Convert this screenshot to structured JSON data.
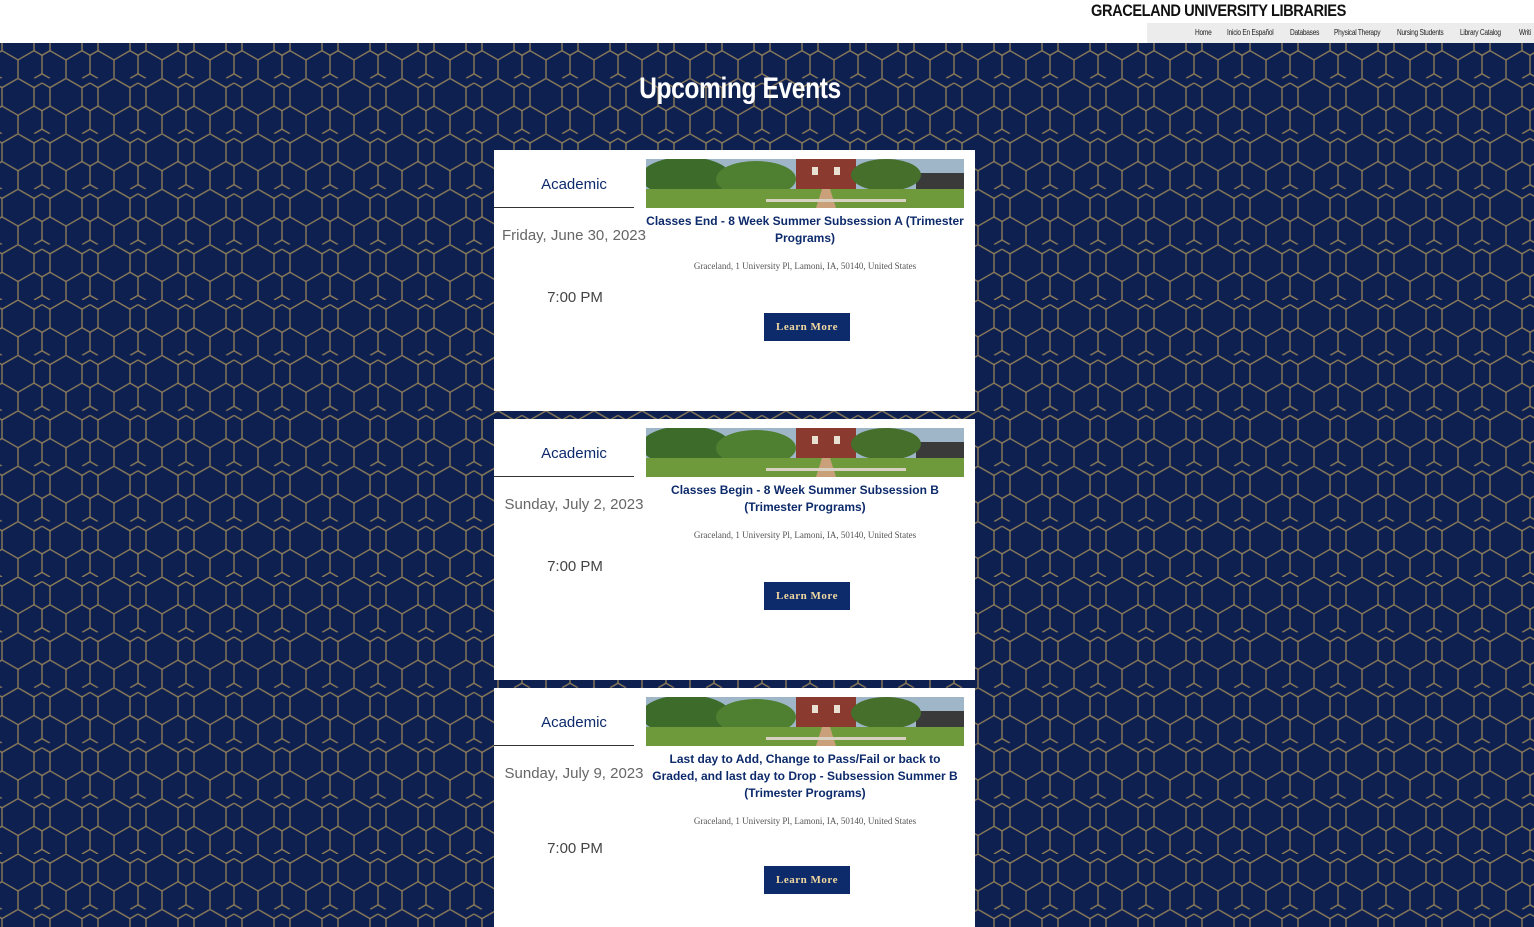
{
  "header": {
    "site_title": "GRACELAND UNIVERSITY LIBRARIES",
    "nav_items": [
      "Home",
      "Inicio En Español",
      "Databases",
      "Physical Therapy",
      "Nursing Students",
      "Library Catalog",
      "Writi"
    ]
  },
  "colors": {
    "background": "#0d2050",
    "hex_line": "#a08a5a",
    "accent": "#0d2a6b",
    "button_text": "#f0d9a0"
  },
  "section": {
    "title": "Upcoming Events"
  },
  "events": [
    {
      "category": "Academic",
      "date": "Friday, June 30, 2023",
      "time": "7:00 PM",
      "title": "Classes End - 8 Week Summer Subsession A (Trimester Programs)",
      "location": "Graceland, 1 University Pl, Lamoni, IA, 50140, United States",
      "button": "Learn More"
    },
    {
      "category": "Academic",
      "date": "Sunday, July 2, 2023",
      "time": "7:00 PM",
      "title": "Classes Begin - 8 Week Summer Subsession B (Trimester Programs)",
      "location": "Graceland, 1 University Pl, Lamoni, IA, 50140, United States",
      "button": "Learn More"
    },
    {
      "category": "Academic",
      "date": "Sunday, July 9, 2023",
      "time": "7:00 PM",
      "title": "Last day to Add, Change to Pass/Fail or back to Graded, and last day to Drop - Subsession Summer B (Trimester Programs)",
      "location": "Graceland, 1 University Pl, Lamoni, IA, 50140, United States",
      "button": "Learn More"
    }
  ]
}
